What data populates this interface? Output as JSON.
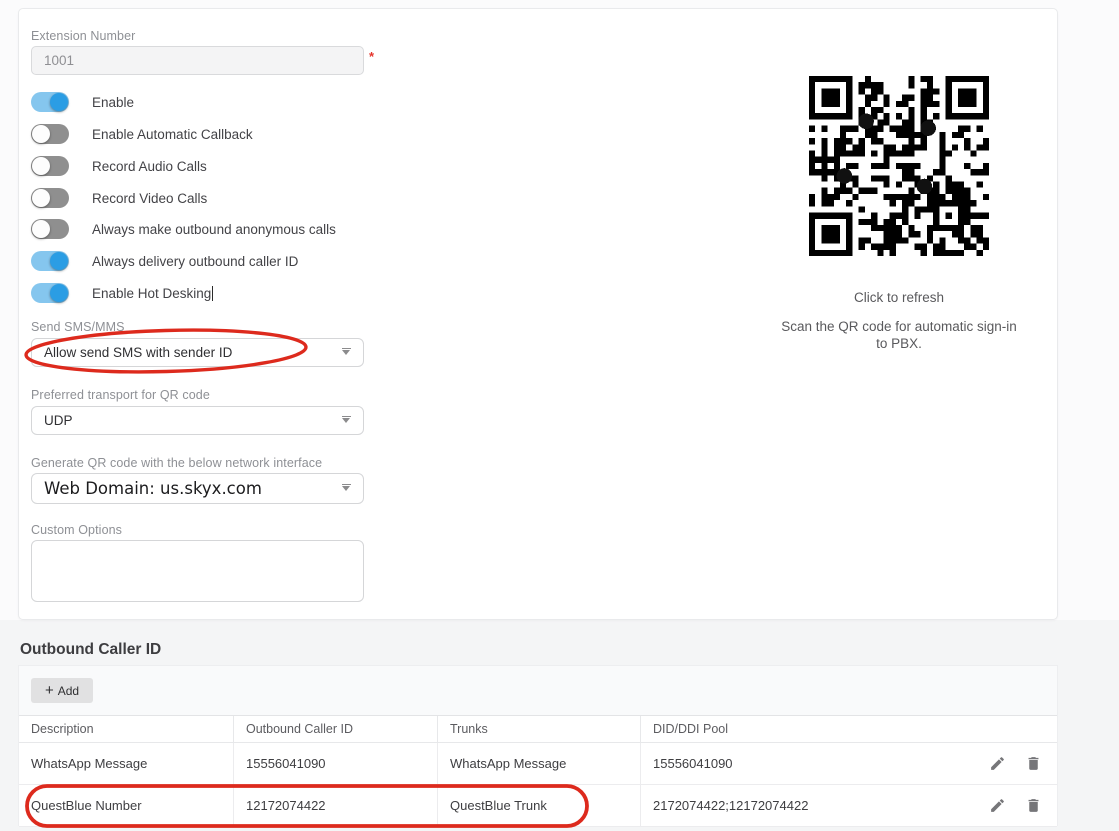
{
  "form": {
    "extension_number": {
      "label": "Extension Number",
      "value": "1001",
      "required_mark": "*"
    },
    "toggles": [
      {
        "label": "Enable",
        "on": true
      },
      {
        "label": "Enable Automatic Callback",
        "on": false
      },
      {
        "label": "Record Audio Calls",
        "on": false
      },
      {
        "label": "Record Video Calls",
        "on": false
      },
      {
        "label": "Always make outbound anonymous calls",
        "on": false
      },
      {
        "label": "Always delivery outbound caller ID",
        "on": true
      },
      {
        "label": "Enable Hot Desking",
        "on": true
      }
    ],
    "send_sms": {
      "label": "Send SMS/MMS",
      "value": "Allow send SMS with sender ID"
    },
    "transport": {
      "label": "Preferred transport for QR code",
      "value": "UDP"
    },
    "network_interface": {
      "label": "Generate QR code with the below network interface",
      "value": "Web Domain: us.skyx.com"
    },
    "custom_options": {
      "label": "Custom Options",
      "value": ""
    }
  },
  "qr_panel": {
    "refresh_label": "Click to refresh",
    "hint": "Scan the QR code for automatic sign-in to PBX."
  },
  "outbound": {
    "title": "Outbound Caller ID",
    "add_button_label": "Add",
    "add_button_plus": "+",
    "columns": [
      "Description",
      "Outbound Caller ID",
      "Trunks",
      "DID/DDI Pool"
    ],
    "rows": [
      {
        "description": "WhatsApp Message",
        "caller_id": "15556041090",
        "trunks": "WhatsApp Message",
        "did_pool": "15556041090"
      },
      {
        "description": "QuestBlue Number",
        "caller_id": "12172074422",
        "trunks": "QuestBlue Trunk",
        "did_pool": "2172074422;12172074422"
      }
    ]
  },
  "colors": {
    "toggle_on_knob": "#2b9de4",
    "toggle_on_track": "#85c6ee",
    "toggle_off_track": "#8f8f8f",
    "annotation_red": "#dd2a1d",
    "required_red": "#e5342b"
  }
}
